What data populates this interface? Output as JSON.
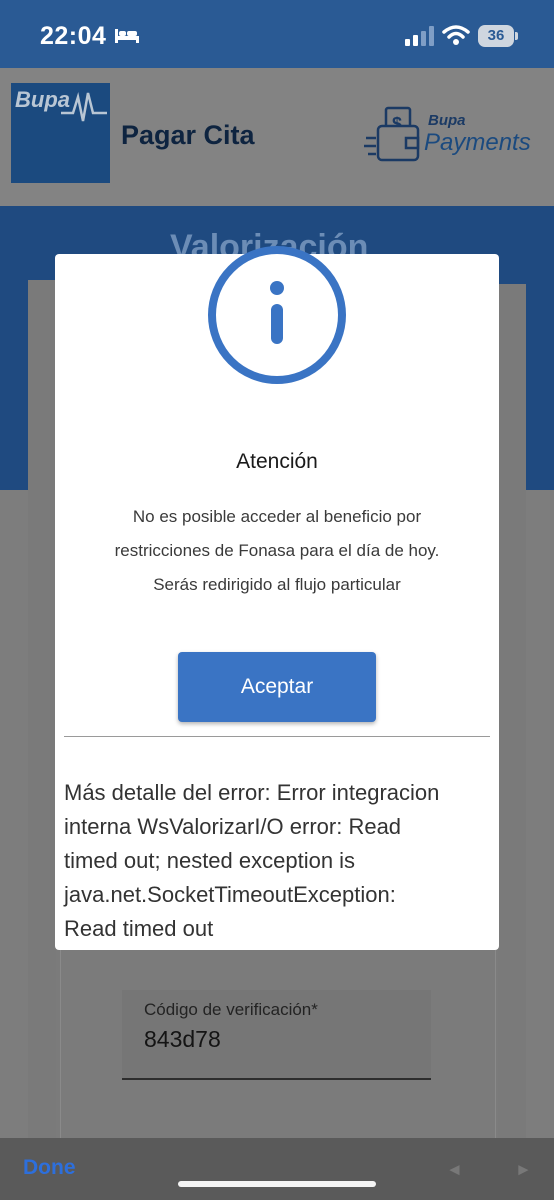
{
  "status_bar": {
    "time": "22:04",
    "battery": "36"
  },
  "header": {
    "brand_logo_text": "Bupa",
    "title": "Pagar Cita",
    "payments_brand": "Bupa",
    "payments_label": "Payments"
  },
  "background": {
    "section_title": "Valorización",
    "verification": {
      "label": "Código de verificación*",
      "value": "843d78"
    }
  },
  "modal": {
    "icon": "info-icon",
    "title": "Atención",
    "message_lines": [
      "No es posible acceder al beneficio por",
      "restricciones de Fonasa para el día de hoy.",
      "Serás redirigido al flujo particular"
    ],
    "accept_label": "Aceptar",
    "error_lines": [
      "Más detalle del error: Error integracion",
      "interna WsValorizarI/O error: Read",
      "timed out; nested exception is",
      "java.net.SocketTimeoutException:",
      "Read timed out"
    ]
  },
  "keyboard_toolbar": {
    "done_label": "Done",
    "prev_icon": "◄",
    "next_icon": "►"
  },
  "colors": {
    "accent": "#3a74c4",
    "brand_dark": "#1b4a7f",
    "status_bar": "#2a5a94"
  }
}
